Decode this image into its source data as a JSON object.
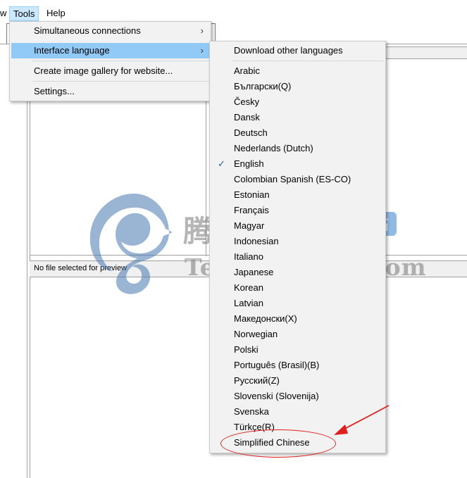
{
  "menubar": {
    "view_label": "w",
    "tools_label": "Tools",
    "help_label": "Help"
  },
  "tools_menu": {
    "items": [
      {
        "label": "Simultaneous connections",
        "has_submenu": true
      },
      {
        "label": "Interface language",
        "has_submenu": true,
        "highlighted": true
      },
      {
        "label": "Create image gallery for website..."
      },
      {
        "label": "Settings..."
      }
    ]
  },
  "language_menu": {
    "download_label": "Download other languages",
    "selected": "English",
    "languages": [
      "Arabic",
      "Български(Q)",
      "Česky",
      "Dansk",
      "Deutsch",
      "Nederlands (Dutch)",
      "English",
      "Colombian Spanish (ES-CO)",
      "Estonian",
      "Français",
      "Magyar",
      "Indonesian",
      "Italiano",
      "Japanese",
      "Korean",
      "Latvian",
      "Македонски(X)",
      "Norwegian",
      "Polski",
      "Português (Brasil)(B)",
      "Русский(Z)",
      "Slovenski (Slovenija)",
      "Svenska",
      "Türkçe(R)",
      "Simplified Chinese"
    ]
  },
  "preview": {
    "status": "No file selected for preview"
  },
  "watermark": {
    "chinese_text": "腾龙工作室",
    "badge_text": "网站",
    "english_text": "Tenlonstudio.com"
  },
  "colors": {
    "menu_bg": "#f2f2f2",
    "highlight": "#91c9f7",
    "annotation": "#e02020"
  }
}
